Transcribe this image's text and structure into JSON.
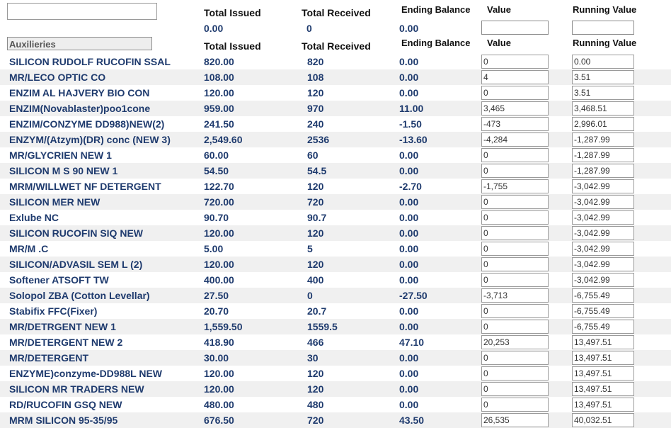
{
  "headers": {
    "total_issued": "Total Issued",
    "total_received": "Total Received",
    "ending_balance": "Ending Balance",
    "value": "Value",
    "running_value": "Running Value"
  },
  "summary": {
    "total_issued": "0.00",
    "total_received": "0",
    "ending_balance": "0.00"
  },
  "section_label": "Auxilieries",
  "rows": [
    {
      "name": "SILICON RUDOLF RUCOFIN SSAL",
      "issued": "820.00",
      "received": "820",
      "ending": "0.00",
      "value": "0",
      "running": "0.00"
    },
    {
      "name": "MR/LECO OPTIC CO",
      "issued": "108.00",
      "received": "108",
      "ending": "0.00",
      "value": "4",
      "running": "3.51"
    },
    {
      "name": "ENZIM AL HAJVERY BIO CON",
      "issued": "120.00",
      "received": "120",
      "ending": "0.00",
      "value": "0",
      "running": "3.51"
    },
    {
      "name": "ENZIM(Novablaster)poo1cone",
      "issued": "959.00",
      "received": "970",
      "ending": "11.00",
      "value": "3,465",
      "running": "3,468.51"
    },
    {
      "name": "ENZIM/CONZYME DD988)NEW(2)",
      "issued": "241.50",
      "received": "240",
      "ending": "-1.50",
      "value": "-473",
      "running": "2,996.01"
    },
    {
      "name": "ENZYM/(Atzym)(DR) conc (NEW 3)",
      "issued": "2,549.60",
      "received": "2536",
      "ending": "-13.60",
      "value": "-4,284",
      "running": "-1,287.99"
    },
    {
      "name": "MR/GLYCRIEN NEW 1",
      "issued": "60.00",
      "received": "60",
      "ending": "0.00",
      "value": "0",
      "running": "-1,287.99"
    },
    {
      "name": "SILICON M S 90  NEW 1",
      "issued": "54.50",
      "received": "54.5",
      "ending": "0.00",
      "value": "0",
      "running": "-1,287.99"
    },
    {
      "name": "MRM/WILLWET NF DETERGENT",
      "issued": "122.70",
      "received": "120",
      "ending": "-2.70",
      "value": "-1,755",
      "running": "-3,042.99"
    },
    {
      "name": "SILICON MER NEW",
      "issued": "720.00",
      "received": "720",
      "ending": "0.00",
      "value": "0",
      "running": "-3,042.99"
    },
    {
      "name": "Exlube NC",
      "issued": "90.70",
      "received": "90.7",
      "ending": "0.00",
      "value": "0",
      "running": "-3,042.99"
    },
    {
      "name": "SILICON RUCOFIN SIQ NEW",
      "issued": "120.00",
      "received": "120",
      "ending": "0.00",
      "value": "0",
      "running": "-3,042.99"
    },
    {
      "name": "MR/M .C",
      "issued": "5.00",
      "received": "5",
      "ending": "0.00",
      "value": "0",
      "running": "-3,042.99"
    },
    {
      "name": "SILICON/ADVASIL SEM L (2)",
      "issued": "120.00",
      "received": "120",
      "ending": "0.00",
      "value": "0",
      "running": "-3,042.99"
    },
    {
      "name": "Softener ATSOFT TW",
      "issued": "400.00",
      "received": "400",
      "ending": "0.00",
      "value": "0",
      "running": "-3,042.99"
    },
    {
      "name": "Solopol ZBA (Cotton Levellar)",
      "issued": "27.50",
      "received": "0",
      "ending": "-27.50",
      "value": "-3,713",
      "running": "-6,755.49"
    },
    {
      "name": "Stabifix FFC(Fixer)",
      "issued": "20.70",
      "received": "20.7",
      "ending": "0.00",
      "value": "0",
      "running": "-6,755.49"
    },
    {
      "name": "MR/DETRGENT NEW 1",
      "issued": "1,559.50",
      "received": "1559.5",
      "ending": "0.00",
      "value": "0",
      "running": "-6,755.49"
    },
    {
      "name": "MR/DETERGENT NEW 2",
      "issued": "418.90",
      "received": "466",
      "ending": "47.10",
      "value": "20,253",
      "running": "13,497.51"
    },
    {
      "name": "MR/DETERGENT",
      "issued": "30.00",
      "received": "30",
      "ending": "0.00",
      "value": "0",
      "running": "13,497.51"
    },
    {
      "name": "ENZYME)conzyme-DD988L NEW",
      "issued": "120.00",
      "received": "120",
      "ending": "0.00",
      "value": "0",
      "running": "13,497.51"
    },
    {
      "name": "SILICON MR TRADERS NEW",
      "issued": "120.00",
      "received": "120",
      "ending": "0.00",
      "value": "0",
      "running": "13,497.51"
    },
    {
      "name": "RD/RUCOFIN  GSQ NEW",
      "issued": "480.00",
      "received": "480",
      "ending": "0.00",
      "value": "0",
      "running": "13,497.51"
    },
    {
      "name": "MRM SILICON 95-35/95",
      "issued": "676.50",
      "received": "720",
      "ending": "43.50",
      "value": "26,535",
      "running": "40,032.51"
    }
  ]
}
